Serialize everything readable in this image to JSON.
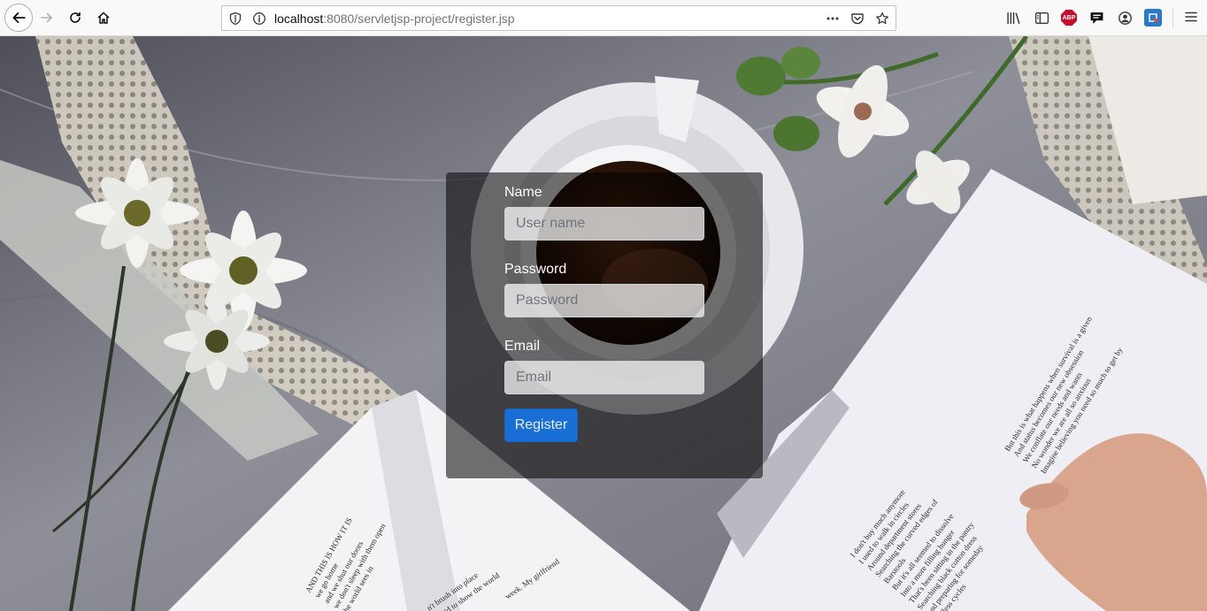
{
  "browser": {
    "url_host": "localhost",
    "url_path": ":8080/servletjsp-project/register.jsp",
    "extensions": {
      "adblock_label": "ABP"
    }
  },
  "form": {
    "name_label": "Name",
    "name_placeholder": "User name",
    "password_label": "Password",
    "password_placeholder": "Password",
    "email_label": "Email",
    "email_placeholder": "Email",
    "register_label": "Register"
  },
  "background": {
    "book_left_lines": [
      "AND THIS IS HOW IT IS",
      "we go home",
      "and we shut our doors",
      "we don't sleep with them open",
      "the world sees in"
    ],
    "book_center_lines": [
      "n't brush into place",
      "afraid to show the world",
      "week. My girlfriend"
    ],
    "book_right_top_lines": [
      "But this is what happens when survival is a given",
      "And status becomes our new obsession",
      "We conflate our needs and wants",
      "No wonder we are all so anxious",
      "Imagine believing you need so much to get by"
    ],
    "book_right_bottom_lines": [
      "I don't buy much anymore",
      "I used to walk in circles",
      "Around department stores",
      "Searching the curved edges of",
      "Barstools",
      "But it's all seemed to dissolve",
      "Into a more filling hunger",
      "That's been sitting in the pantry",
      "Searching black cotton dress",
      "And preparing for someday",
      "Endless cycles"
    ]
  },
  "colors": {
    "primary_button": "#1a6fd6",
    "panel_overlay": "rgba(0,0,0,0.55)"
  }
}
